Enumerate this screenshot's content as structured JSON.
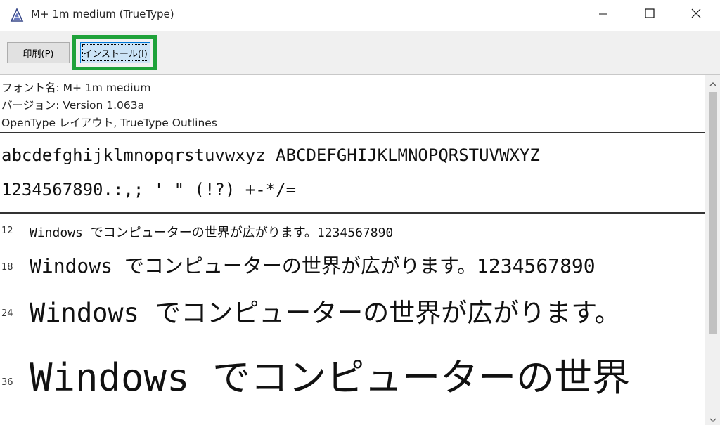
{
  "window": {
    "title": "M+ 1m medium (TrueType)"
  },
  "toolbar": {
    "print_label": "印刷(P)",
    "install_label": "インストール(I)"
  },
  "info": {
    "font_name": "フォント名: M+ 1m medium",
    "version": "バージョン: Version 1.063a",
    "type": "OpenType レイアウト, TrueType Outlines"
  },
  "samples": {
    "alphabet": "abcdefghijklmnopqrstuvwxyz ABCDEFGHIJKLMNOPQRSTUVWXYZ",
    "digits": "1234567890.:,; ' \" (!?) +-*/="
  },
  "size_samples": [
    {
      "size": "12",
      "text": "Windows でコンピューターの世界が広がります。1234567890"
    },
    {
      "size": "18",
      "text": "Windows でコンピューターの世界が広がります。1234567890"
    },
    {
      "size": "24",
      "text": "Windows でコンピューターの世界が広がります。"
    },
    {
      "size": "36",
      "text": "Windows でコンピューターの世界"
    }
  ],
  "colors": {
    "install_highlight": "#1fa23a",
    "install_button_bg": "#cce4f7",
    "toolbar_bg": "#f0f0f0"
  },
  "icons": {
    "app": "font-file-icon",
    "minimize": "minimize-icon",
    "maximize": "maximize-icon",
    "close": "close-icon",
    "scroll_up": "chevron-up-icon",
    "scroll_down": "chevron-down-icon"
  }
}
